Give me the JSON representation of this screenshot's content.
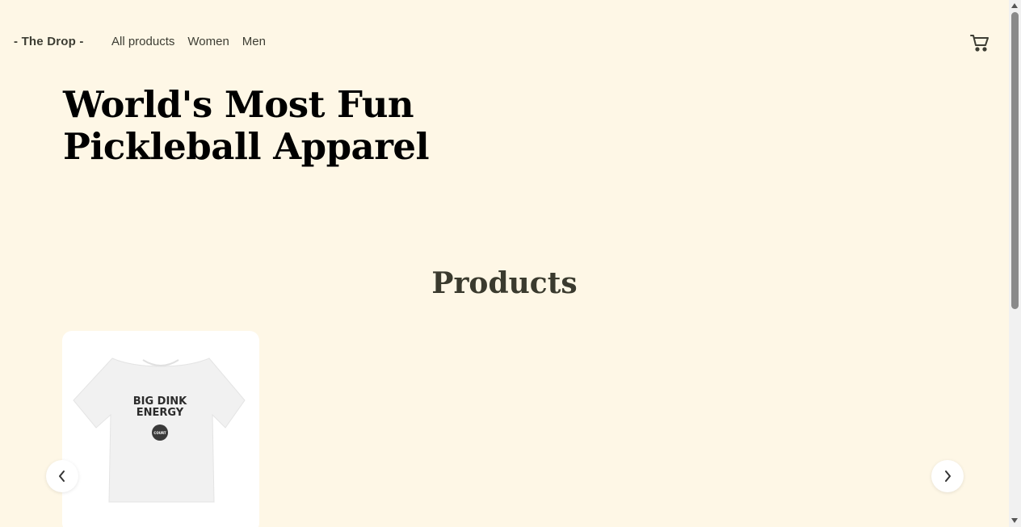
{
  "header": {
    "logo": "- The Drop -",
    "nav": [
      "All products",
      "Women",
      "Men"
    ],
    "cart_icon": "cart-icon"
  },
  "hero": {
    "title_line1": "World's Most Fun",
    "title_line2": "Pickleball Apparel"
  },
  "products": {
    "section_title": "Products",
    "items": [
      {
        "image_text_line1": "BIG DINK",
        "image_text_line2": "ENERGY",
        "image_badge": "COURT"
      }
    ],
    "prev_icon": "chevron-left-icon",
    "next_icon": "chevron-right-icon"
  },
  "colors": {
    "background": "#fef7e6",
    "card": "#ffffff",
    "text_dark": "#3d3d33"
  }
}
